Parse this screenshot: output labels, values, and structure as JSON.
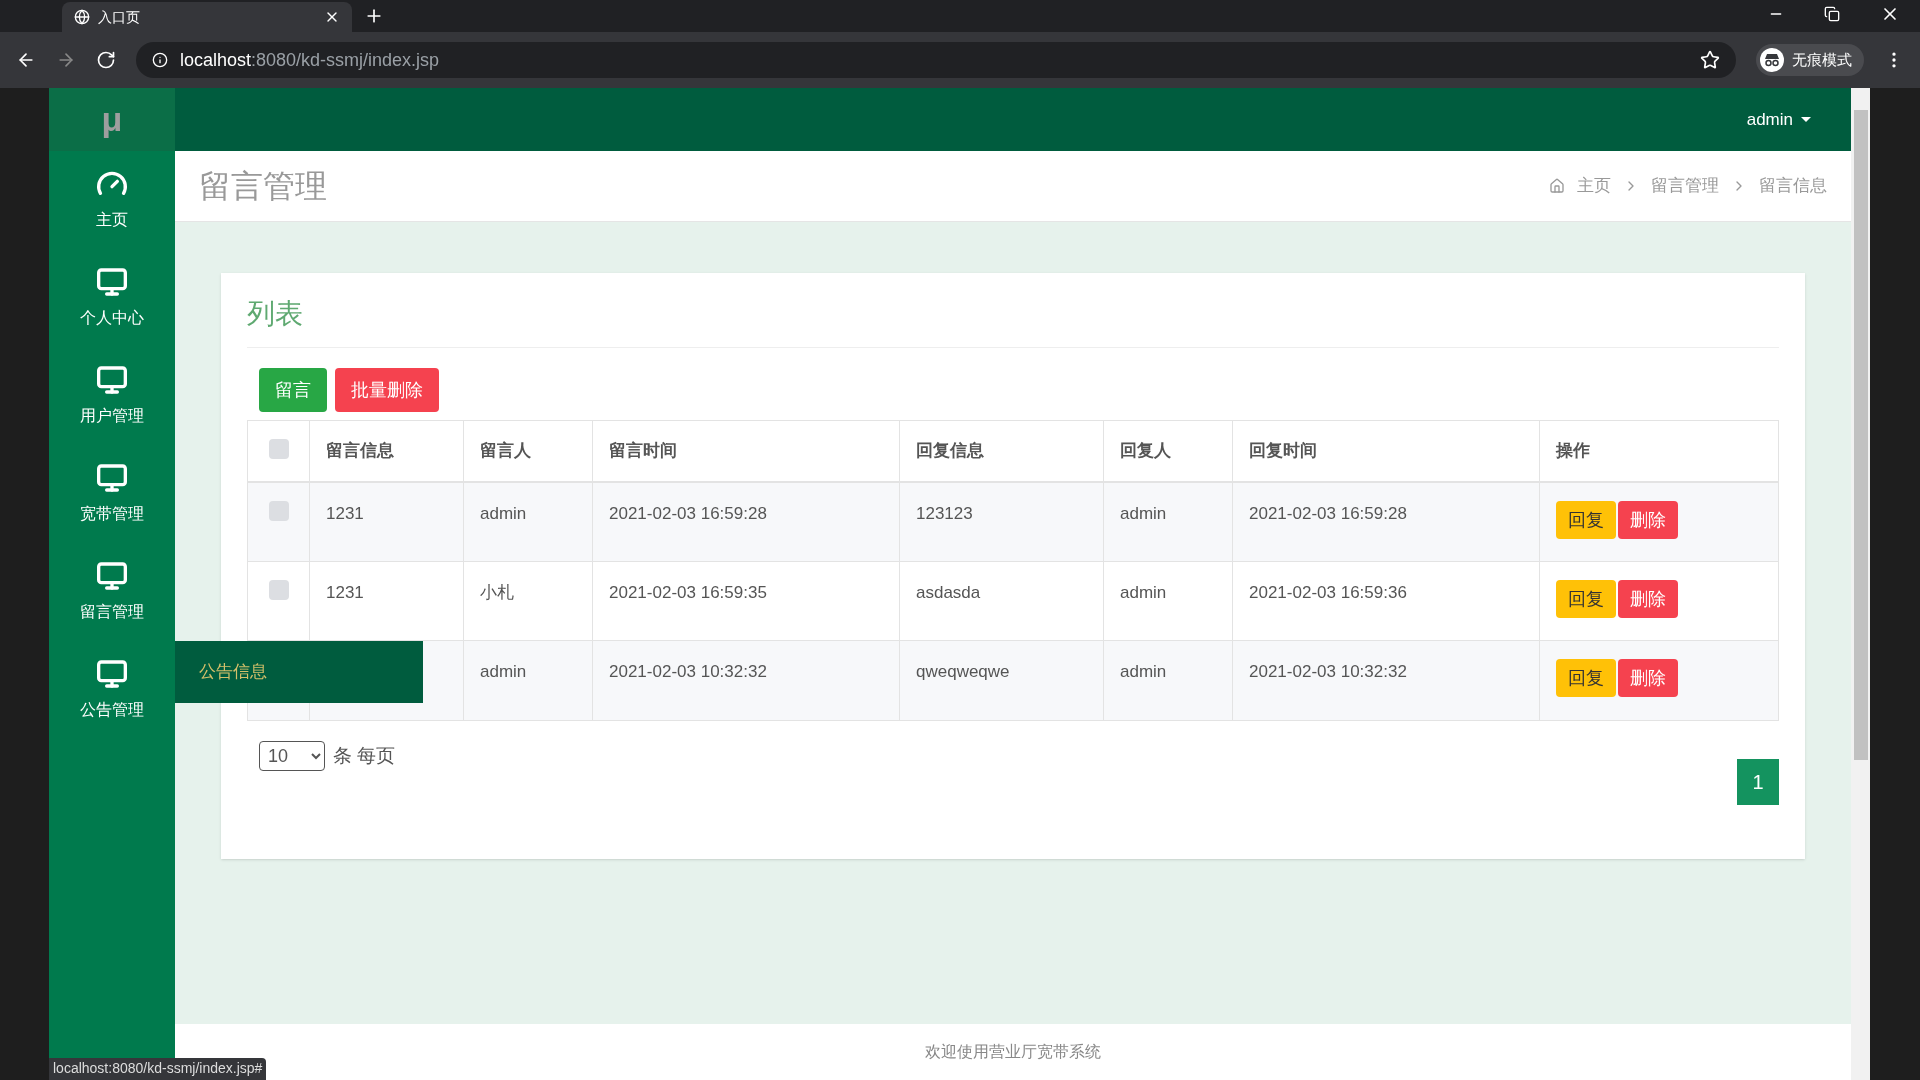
{
  "browser": {
    "tab": {
      "title": "入口页"
    },
    "url_host": "localhost",
    "url_rest": ":8080/kd-ssmj/index.jsp",
    "profile": "无痕模式"
  },
  "sidebar": {
    "logo": "μ",
    "items": [
      {
        "label": "主页",
        "kind": "dashboard"
      },
      {
        "label": "个人中心",
        "kind": "screen"
      },
      {
        "label": "用户管理",
        "kind": "screen"
      },
      {
        "label": "宽带管理",
        "kind": "screen"
      },
      {
        "label": "留言管理",
        "kind": "screen"
      },
      {
        "label": "公告管理",
        "kind": "screen"
      }
    ]
  },
  "flyout": {
    "label": "公告信息"
  },
  "topbar": {
    "user": "admin"
  },
  "page": {
    "title": "留言管理",
    "breadcrumb": [
      "主页",
      "留言管理",
      "留言信息"
    ]
  },
  "card": {
    "title": "列表",
    "buttons": [
      {
        "label": "留言",
        "kind": "primary"
      },
      {
        "label": "批量删除",
        "kind": "danger"
      }
    ],
    "table": {
      "header_checked": false,
      "columns": [
        "留言信息",
        "留言人",
        "留言时间",
        "回复信息",
        "回复人",
        "回复时间",
        "操作"
      ],
      "rows": [
        {
          "checked": false,
          "message": "1231",
          "author": "admin",
          "time": "2021-02-03 16:59:28",
          "reply": "123123",
          "replier": "admin",
          "reply_time": "2021-02-03 16:59:28",
          "actions": [
            {
              "label": "回复",
              "kind": "warning"
            },
            {
              "label": "删除",
              "kind": "danger"
            }
          ]
        },
        {
          "checked": false,
          "message": "1231",
          "author": "小札",
          "time": "2021-02-03 16:59:35",
          "reply": "asdasda",
          "replier": "admin",
          "reply_time": "2021-02-03 16:59:36",
          "actions": [
            {
              "label": "回复",
              "kind": "warning"
            },
            {
              "label": "删除",
              "kind": "danger"
            }
          ]
        },
        {
          "author": "admin",
          "time": "2021-02-03 10:32:32",
          "reply": "qweqweqwe",
          "replier": "admin",
          "reply_time": "2021-02-03 10:32:32",
          "actions": [
            {
              "label": "回复",
              "kind": "warning"
            },
            {
              "label": "删除",
              "kind": "danger"
            }
          ]
        }
      ]
    },
    "page_size": "10",
    "page_size_suffix": "条 每页",
    "pages": [
      {
        "label": "1",
        "selected": true
      }
    ]
  },
  "footer": "欢迎使用营业厅宽带系统",
  "status_url": "localhost:8080/kd-ssmj/index.jsp#"
}
